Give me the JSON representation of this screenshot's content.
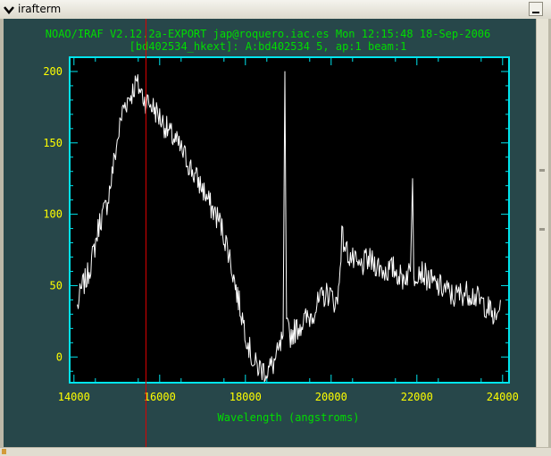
{
  "window": {
    "title": "irafterm"
  },
  "colors": {
    "terminal_bg": "#27474a",
    "plot_bg": "#000000",
    "frame": "#00e5ee",
    "header_text": "#00dd00",
    "tick_labels": "#ffff00",
    "axis_label": "#00dd00",
    "spectrum": "#ffffff",
    "cursor_line": "#dd0000"
  },
  "plot": {
    "header_line1": "NOAO/IRAF V2.12.2a-EXPORT jap@roquero.iac.es Mon 12:15:48 18-Sep-2006",
    "header_line2": "[bd402534_hkext]: A:bd402534 5, ap:1 beam:1",
    "xlabel": "Wavelength (angstroms)"
  },
  "chart_data": {
    "type": "line",
    "xlim": [
      13900,
      24150
    ],
    "ylim": [
      -18,
      210
    ],
    "x_ticks": [
      "14000",
      "16000",
      "18000",
      "20000",
      "22000",
      "24000"
    ],
    "y_ticks": [
      "0",
      "50",
      "100",
      "150",
      "200"
    ],
    "xlabel": "Wavelength (angstroms)",
    "cursor_x": 15680,
    "series": [
      {
        "x": [
          14080,
          14200,
          14300,
          14450,
          14600,
          14750,
          14850,
          14950,
          15050,
          15150,
          15250,
          15350,
          15450,
          15550,
          15650,
          15750,
          15850,
          16000,
          16200,
          16400,
          16600,
          16800,
          17000,
          17200,
          17400,
          17600,
          17800,
          17950,
          18100,
          18200,
          18350,
          18500,
          18650,
          18800,
          18880,
          18920,
          18960,
          19050,
          19200,
          19350,
          19500,
          19650,
          19800,
          19950,
          20050,
          20150,
          20250,
          20350,
          20450,
          20650,
          20850,
          21050,
          21250,
          21450,
          21650,
          21850,
          21900,
          21930,
          21960,
          22050,
          22250,
          22450,
          22650,
          22850,
          23050,
          23250,
          23450,
          23650,
          23850,
          23950
        ],
        "y": [
          35,
          50,
          55,
          72,
          95,
          105,
          120,
          140,
          158,
          175,
          180,
          185,
          192,
          187,
          180,
          178,
          175,
          168,
          158,
          150,
          140,
          128,
          118,
          105,
          95,
          75,
          45,
          25,
          5,
          -5,
          -8,
          -10,
          -5,
          5,
          15,
          200,
          20,
          15,
          20,
          25,
          28,
          35,
          42,
          45,
          40,
          38,
          85,
          75,
          70,
          62,
          68,
          65,
          60,
          62,
          55,
          60,
          125,
          55,
          58,
          62,
          55,
          50,
          48,
          42,
          45,
          45,
          40,
          35,
          25,
          40
        ]
      }
    ]
  }
}
